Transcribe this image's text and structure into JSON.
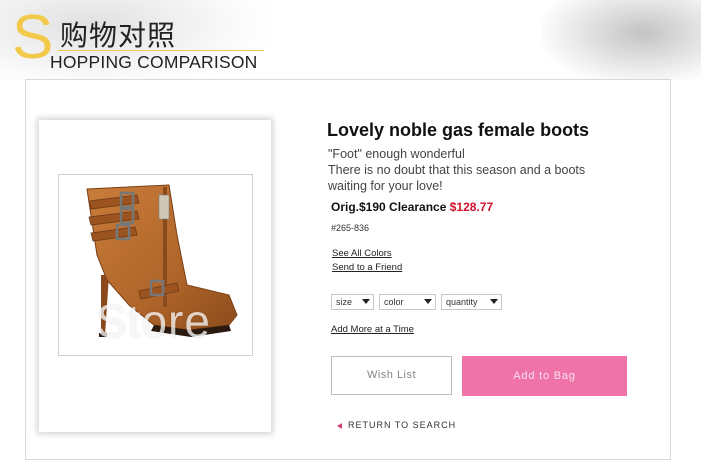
{
  "header": {
    "big_letter": "S",
    "title_cn": "购物对照",
    "title_en": "HOPPING COMPARISON"
  },
  "product": {
    "title": "Lovely noble gas female boots",
    "description": [
      "\"Foot\" enough wonderful",
      "There is no doubt that this season and a boots",
      "waiting for your love!"
    ],
    "price_label": "Orig.$190 Clearance ",
    "sale_price": "$128.77",
    "sku": "#265-836",
    "links": {
      "see_all_colors": "See All Colors",
      "send_to_friend": "Send to a Friend",
      "add_more": "Add More at a Time"
    },
    "selects": {
      "size": "size",
      "color": "color",
      "quantity": "quantity"
    },
    "buttons": {
      "wish_list": "Wish   List",
      "add_to_bag": "Add  to  Bag"
    },
    "return_link": "RETURN TO SEARCH",
    "watermark": "Store"
  },
  "colors": {
    "accent_yellow": "#f3c94a",
    "sale_red": "#d0102a",
    "bag_pink": "#ef73a8",
    "boot_brown": "#b36a2a"
  },
  "icons": {
    "return": "triangle-left-icon",
    "select": "chevron-down-icon"
  }
}
